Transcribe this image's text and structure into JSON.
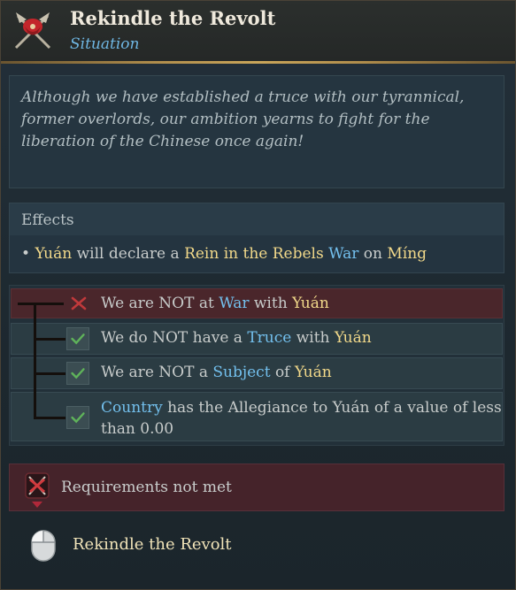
{
  "header": {
    "title": "Rekindle the Revolt",
    "subtitle": "Situation"
  },
  "description": "Although we have established a truce with our tyrannical, former overlords, our ambition yearns to fight for the liberation of the Chinese once again!",
  "effects": {
    "title": "Effects",
    "bullet": "•",
    "parts": [
      "Yuán",
      "will declare a",
      "Rein in the Rebels",
      "War",
      "on",
      "Míng"
    ]
  },
  "triggers": [
    {
      "status": "failed",
      "parts": [
        "We are NOT at ",
        "War",
        " with ",
        "Yuán"
      ]
    },
    {
      "status": "met",
      "parts": [
        "We do NOT have a ",
        "Truce",
        " with ",
        "Yuán"
      ]
    },
    {
      "status": "met",
      "parts": [
        "We are NOT a ",
        "Subject",
        " of ",
        "Yuán"
      ]
    },
    {
      "status": "met",
      "parts": [
        "Country",
        " has the Allegiance to Yuán of a value of less",
        "than 0.00"
      ]
    }
  ],
  "requirements": {
    "label": "Requirements not met"
  },
  "action": {
    "label": "Rekindle the Revolt"
  },
  "colors": {
    "highlight_yellow": "#f2d98a",
    "highlight_blue": "#73c0ee",
    "fail_red": "#c0393b",
    "check_green": "#5fb35a",
    "gold_rule": "#c9a55a"
  },
  "icons": {
    "emblem": "rebel-flag-emblem-icon",
    "fail": "red-x-icon",
    "met": "green-check-icon",
    "requirements": "crossed-sword-x-icon",
    "mouse": "left-click-mouse-icon"
  }
}
